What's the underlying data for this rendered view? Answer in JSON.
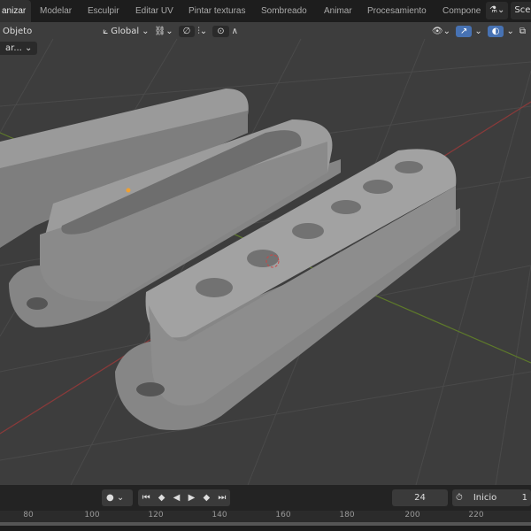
{
  "tabs": [
    "anizar",
    "Modelar",
    "Esculpir",
    "Editar UV",
    "Pintar texturas",
    "Sombreado",
    "Animar",
    "Procesamiento",
    "Compone"
  ],
  "scene_label": "Scen",
  "header": {
    "mode": "Objeto",
    "orientation": "Global",
    "sub_menu": "ar..."
  },
  "timeline": {
    "current_frame": "24",
    "start_label": "Inicio",
    "start_value": "1"
  },
  "ruler": [
    "80",
    "100",
    "120",
    "140",
    "160",
    "180",
    "200",
    "220"
  ],
  "colors": {
    "accent": "#4772b3",
    "x_axis": "#b53c3c",
    "y_axis": "#7a9a2c",
    "object": "#8f8f8f"
  }
}
